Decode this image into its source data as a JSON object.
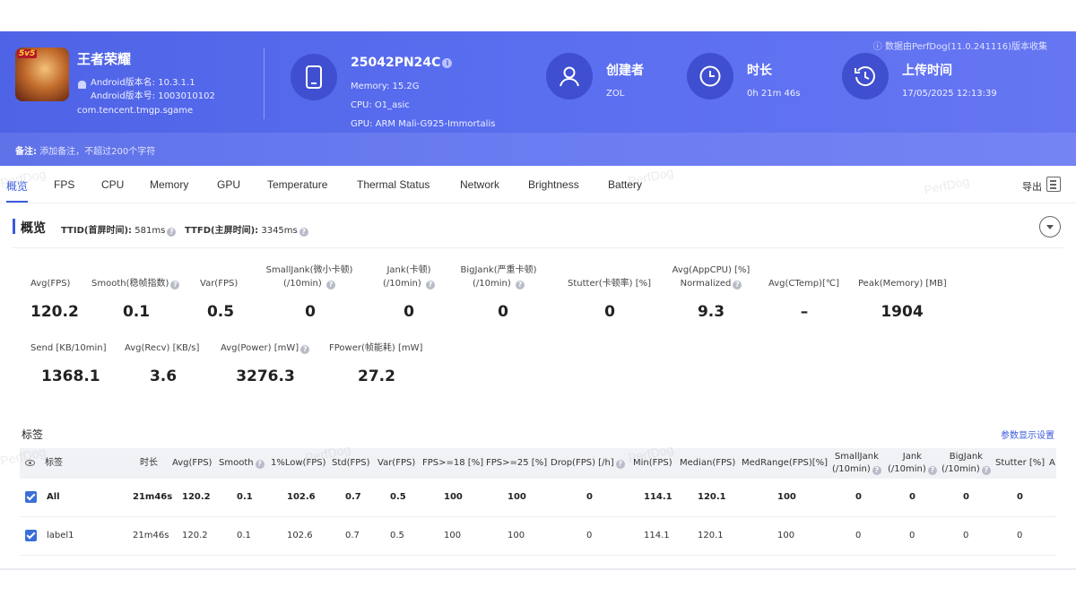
{
  "header": {
    "source_note": "ⓘ 数据由PerfDog(11.0.241116)版本收集",
    "app": {
      "name": "王者荣耀",
      "icon_tag": "5v5",
      "version_name": "Android版本名: 10.3.1.1",
      "version_code": "Android版本号: 1003010102",
      "package": "com.tencent.tmgp.sgame"
    },
    "device": {
      "model": "25042PN24C",
      "memory": "Memory: 15.2G",
      "cpu": "CPU: O1_asic",
      "gpu": "GPU: ARM Mali-G925-Immortalis"
    },
    "creator": {
      "title": "创建者",
      "value": "ZOL"
    },
    "duration": {
      "title": "时长",
      "value": "0h 21m 46s"
    },
    "upload": {
      "title": "上传时间",
      "value": "17/05/2025 12:13:39"
    },
    "note": {
      "label": "备注:",
      "placeholder": "添加备注，不超过200个字符"
    }
  },
  "tabs": [
    "概览",
    "FPS",
    "CPU",
    "Memory",
    "GPU",
    "Temperature",
    "Thermal Status",
    "Network",
    "Brightness",
    "Battery"
  ],
  "export_label": "导出",
  "watermark": "PerfDog",
  "overview": {
    "title": "概览",
    "ttid_label": "TTID(首屏时间):",
    "ttid_value": "581ms",
    "ttfd_label": "TTFD(主屏时间):",
    "ttfd_value": "3345ms",
    "metrics_row1": [
      {
        "label": "Avg(FPS)",
        "value": "120.2"
      },
      {
        "label": "Smooth(稳帧指数)",
        "value": "0.1"
      },
      {
        "label": "Var(FPS)",
        "value": "0.5"
      },
      {
        "label": "SmallJank(微小卡顿)",
        "label2": "(/10min)",
        "value": "0"
      },
      {
        "label": "Jank(卡顿)",
        "label2": "(/10min)",
        "value": "0"
      },
      {
        "label": "BigJank(严重卡顿)",
        "label2": "(/10min)",
        "value": "0"
      },
      {
        "label": "Stutter(卡顿率) [%]",
        "value": "0"
      },
      {
        "label": "Avg(AppCPU) [%]",
        "label2": "Normalized",
        "value": "9.3"
      },
      {
        "label": "Avg(CTemp)[℃]",
        "value": "–"
      },
      {
        "label": "Peak(Memory) [MB]",
        "value": "1904"
      }
    ],
    "metrics_row2": [
      {
        "label": "Send [KB/10min]",
        "value": "1368.1"
      },
      {
        "label": "Avg(Recv) [KB/s]",
        "value": "3.6"
      },
      {
        "label": "Avg(Power) [mW]",
        "value": "3276.3"
      },
      {
        "label": "FPower(帧能耗) [mW]",
        "value": "27.2"
      }
    ]
  },
  "tags": {
    "title": "标签",
    "settings_link": "参数显示设置",
    "columns": [
      "标签",
      "时长",
      "Avg(FPS)",
      "Smooth",
      "1%Low(FPS)",
      "Std(FPS)",
      "Var(FPS)",
      "FPS>=18 [%]",
      "FPS>=25 [%]",
      "Drop(FPS) [/h]",
      "Min(FPS)",
      "Median(FPS)",
      "MedRange(FPS)[%]",
      "SmallJank",
      "Jank",
      "BigJank",
      "Stutter [%]",
      "A"
    ],
    "columns_sub": {
      "smalljank": "(/10min)",
      "jank": "(/10min)",
      "bigjank": "(/10min)"
    },
    "rows": [
      [
        "All",
        "21m46s",
        "120.2",
        "0.1",
        "102.6",
        "0.7",
        "0.5",
        "100",
        "100",
        "0",
        "114.1",
        "120.1",
        "100",
        "0",
        "0",
        "0",
        "0"
      ],
      [
        "label1",
        "21m46s",
        "120.2",
        "0.1",
        "102.6",
        "0.7",
        "0.5",
        "100",
        "100",
        "0",
        "114.1",
        "120.1",
        "100",
        "0",
        "0",
        "0",
        "0"
      ]
    ]
  }
}
